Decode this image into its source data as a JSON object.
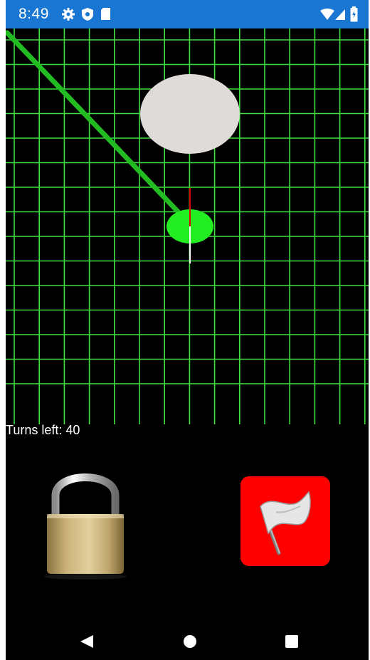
{
  "status_bar": {
    "time": "8:49",
    "icons": [
      "gear-icon",
      "shield-icon",
      "sd-card-icon",
      "wifi-icon",
      "signal-icon",
      "battery-icon"
    ],
    "color": "#1976d2"
  },
  "game": {
    "turns_label": "Turns left: 40",
    "grid_color": "#3fe03f",
    "ball_color": "#22ee22",
    "target_color": "#dedbd9",
    "aim_line_color": "#22bb22",
    "direction_indicator_color": "#dd0000"
  },
  "controls": {
    "lock_icon": "padlock-icon",
    "flag_icon": "white-flag-icon",
    "flag_button_color": "#ff0000"
  },
  "nav_bar": {
    "buttons": [
      "back-icon",
      "home-icon",
      "recents-icon"
    ]
  }
}
